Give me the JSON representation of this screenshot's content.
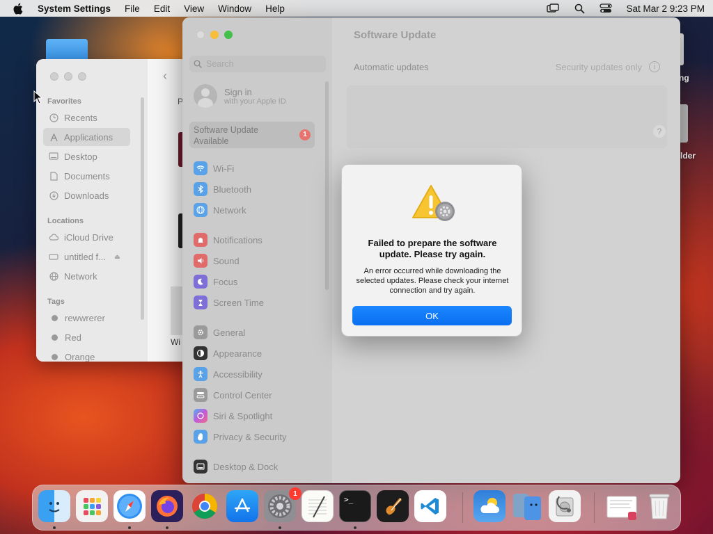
{
  "menubar": {
    "app_name": "System Settings",
    "menus": [
      "File",
      "Edit",
      "View",
      "Window",
      "Help"
    ],
    "clock": "Sat Mar 2  9:23 PM"
  },
  "desktop": {
    "right_labels": [
      "ng",
      "lder"
    ]
  },
  "finder": {
    "favorites_header": "Favorites",
    "favorites": [
      "Recents",
      "Applications",
      "Desktop",
      "Documents",
      "Downloads"
    ],
    "locations_header": "Locations",
    "locations": [
      "iCloud Drive",
      "untitled f...",
      "Network"
    ],
    "tags_header": "Tags",
    "tags": [
      "rewwrerer",
      "Red",
      "Orange"
    ],
    "content_letter": "P",
    "wi_label": "Wi"
  },
  "settings": {
    "title": "Software Update",
    "search_placeholder": "Search",
    "signin_title": "Sign in",
    "signin_subtitle": "with your Apple ID",
    "update_available": "Software Update Available",
    "update_badge": "1",
    "sidebar_items": [
      {
        "label": "Wi-Fi",
        "color": "#5aa2e8"
      },
      {
        "label": "Bluetooth",
        "color": "#5aa2e8"
      },
      {
        "label": "Network",
        "color": "#5aa2e8"
      },
      {
        "label": "Notifications",
        "color": "#e06b6b"
      },
      {
        "label": "Sound",
        "color": "#e06b6b"
      },
      {
        "label": "Focus",
        "color": "#7d6fd6"
      },
      {
        "label": "Screen Time",
        "color": "#7d6fd6"
      },
      {
        "label": "General",
        "color": "#9a9a9a"
      },
      {
        "label": "Appearance",
        "color": "#333333"
      },
      {
        "label": "Accessibility",
        "color": "#5aa2e8"
      },
      {
        "label": "Control Center",
        "color": "#9a9a9a"
      },
      {
        "label": "Siri & Spotlight",
        "color": "#c27ad9"
      },
      {
        "label": "Privacy & Security",
        "color": "#5aa2e8"
      },
      {
        "label": "Desktop & Dock",
        "color": "#333333"
      }
    ],
    "automatic_updates_label": "Automatic updates",
    "automatic_updates_value": "Security updates only",
    "info": "i",
    "help": "?"
  },
  "alert": {
    "headline": "Failed to prepare the software update. Please try again.",
    "body": "An error occurred while downloading the selected updates. Please check your internet connection and try again.",
    "ok_label": "OK"
  },
  "dock": {
    "settings_badge": "1",
    "apps": [
      "finder-icon",
      "launchpad-icon",
      "safari-icon",
      "firefox-icon",
      "chrome-icon",
      "app-store-icon",
      "system-settings-icon",
      "textedit-icon",
      "terminal-icon",
      "garageband-icon",
      "vscode-icon",
      "weather-icon",
      "migration-icon",
      "disk-utility-icon",
      "document-icon",
      "trash-icon"
    ]
  }
}
